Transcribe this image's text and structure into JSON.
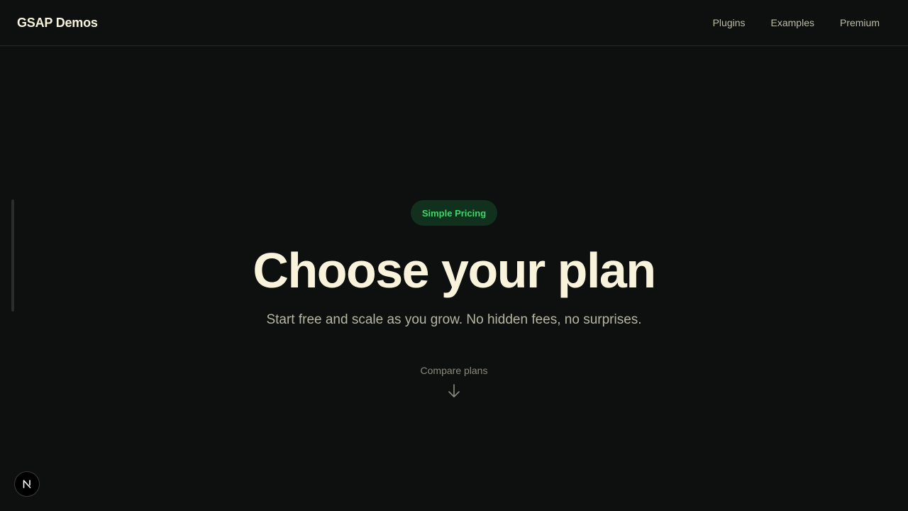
{
  "header": {
    "brand": "GSAP Demos",
    "nav": [
      {
        "label": "Plugins"
      },
      {
        "label": "Examples"
      },
      {
        "label": "Premium"
      }
    ]
  },
  "hero": {
    "badge": "Simple Pricing",
    "title": "Choose your plan",
    "subtitle": "Start free and scale as you grow. No hidden fees, no surprises.",
    "compare_label": "Compare plans",
    "compare_icon": "arrow-down-icon"
  },
  "dev_badge": {
    "icon": "nextjs-logo-icon"
  },
  "colors": {
    "background": "#0e1010",
    "text": "#f8f3da",
    "accent": "#3fd56b",
    "badge_bg": "#11301d",
    "muted": "#b7b5a3"
  }
}
